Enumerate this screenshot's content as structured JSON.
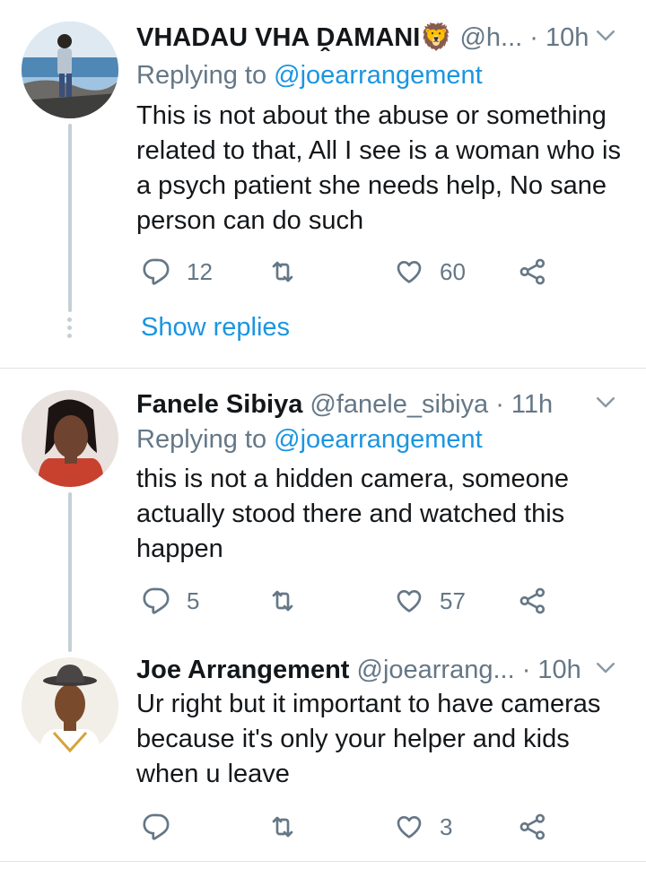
{
  "tweets": [
    {
      "name": "VHADAU VHA ḒAMANI",
      "emoji": "🦁",
      "handle": "@h...",
      "time": "· 10h",
      "reply_prefix": "Replying to",
      "reply_mention": "@joearrangement",
      "text": "This is not about the abuse or something related to that, All I see is a woman who is a psych patient she needs help, No sane person can do such",
      "replies": "12",
      "retweets": "",
      "likes": "60",
      "show_replies": "Show replies"
    },
    {
      "name": "Fanele Sibiya",
      "handle": "@fanele_sibiya",
      "time": "· 11h",
      "reply_prefix": "Replying to",
      "reply_mention": "@joearrangement",
      "text": "this is not a hidden camera, someone actually stood there and watched this happen",
      "replies": "5",
      "retweets": "",
      "likes": "57"
    },
    {
      "name": "Joe Arrangement",
      "handle": "@joearrang...",
      "time": "· 10h",
      "text": "Ur right but it important to have cameras because it's only your helper and kids when u leave",
      "replies": "",
      "retweets": "",
      "likes": "3"
    }
  ],
  "colors": {
    "link": "#1b95e0",
    "secondary": "#657786",
    "thread_line": "#c4cfd6"
  },
  "icons": [
    "reply-icon",
    "retweet-icon",
    "like-icon",
    "share-icon",
    "chevron-down-icon"
  ]
}
